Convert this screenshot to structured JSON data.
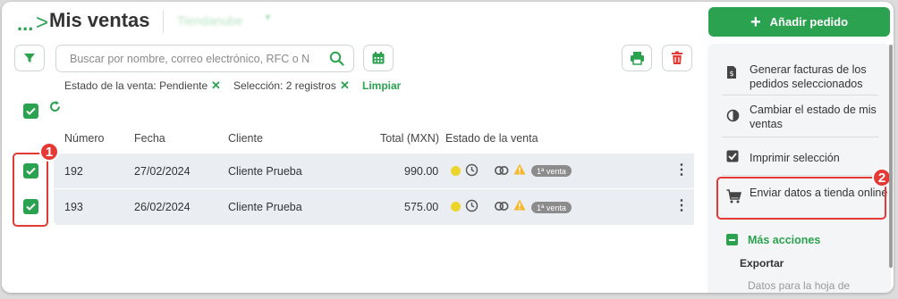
{
  "header": {
    "breadcrumb_dots": "...",
    "breadcrumb_arrow": ">",
    "title": "Mis ventas",
    "store_name": "Tiendanube",
    "add_button": "Añadir pedido"
  },
  "search": {
    "placeholder": "Buscar por nombre, correo electrónico, RFC o N"
  },
  "filters": {
    "state_filter": "Estado de la venta: Pendiente",
    "selection_filter": "Selección: 2 registros",
    "clear": "Limpiar"
  },
  "table": {
    "columns": [
      "Número",
      "Fecha",
      "Cliente",
      "Total (MXN)",
      "Estado de la venta"
    ],
    "rows": [
      {
        "number": "192",
        "date": "27/02/2024",
        "client": "Cliente Prueba",
        "total": "990.00",
        "badge": "1ª venta"
      },
      {
        "number": "193",
        "date": "26/02/2024",
        "client": "Cliente Prueba",
        "total": "575.00",
        "badge": "1ª venta"
      }
    ]
  },
  "side_menu": {
    "items": [
      "Generar facturas de los pedidos seleccionados",
      "Cambiar el estado de mis ventas",
      "Imprimir selección",
      "Enviar datos a tienda online"
    ],
    "more_actions": "Más acciones",
    "export_heading": "Exportar",
    "export_sub": "Datos para la hoja de"
  },
  "annotations": {
    "step1": "1",
    "step2": "2"
  },
  "colors": {
    "accent": "#2aa24f",
    "danger": "#e53935",
    "row_bg": "#eaedf2",
    "status_dot": "#ecd52a",
    "warning": "#f5b82e"
  }
}
